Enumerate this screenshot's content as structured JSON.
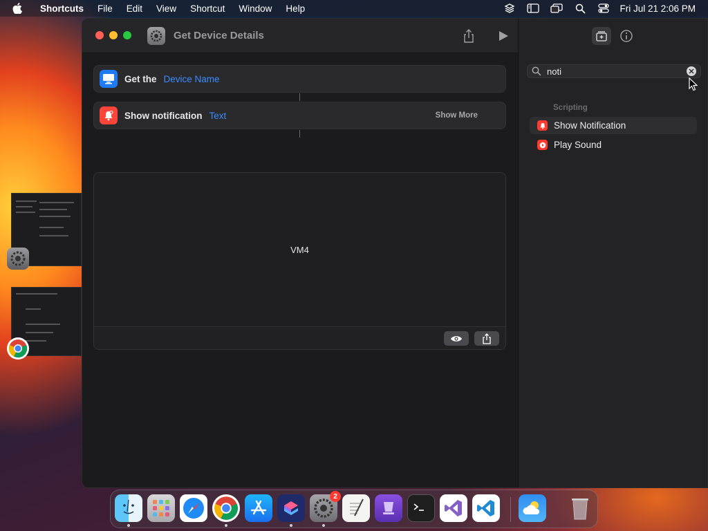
{
  "menubar": {
    "app_name": "Shortcuts",
    "items": [
      "File",
      "Edit",
      "View",
      "Shortcut",
      "Window",
      "Help"
    ],
    "clock": "Fri Jul 21  2:06 PM"
  },
  "window": {
    "title": "Get Device Details"
  },
  "actions": [
    {
      "label": "Get the",
      "param": "Device Name",
      "icon": "display-icon",
      "color": "#1e7bf5"
    },
    {
      "label": "Show notification",
      "param": "Text",
      "more": "Show More",
      "icon": "bell-icon",
      "color": "#ff453a"
    }
  ],
  "result": {
    "text": "VM4"
  },
  "sidebar": {
    "search": {
      "value": "noti"
    },
    "section_title": "Scripting",
    "results": [
      {
        "label": "Show Notification",
        "icon": "bell-icon"
      },
      {
        "label": "Play Sound",
        "icon": "play-icon"
      }
    ]
  },
  "dock": {
    "settings_badge": "2",
    "apps": [
      "finder",
      "launchpad",
      "safari",
      "chrome",
      "app-store",
      "shortcuts",
      "system-settings",
      "textedit",
      "xcode-instruments",
      "terminal",
      "visual-studio",
      "vscode",
      "weather",
      "trash"
    ]
  },
  "colors": {
    "accent": "#3a8cff",
    "notification_red": "#ff3b30"
  }
}
